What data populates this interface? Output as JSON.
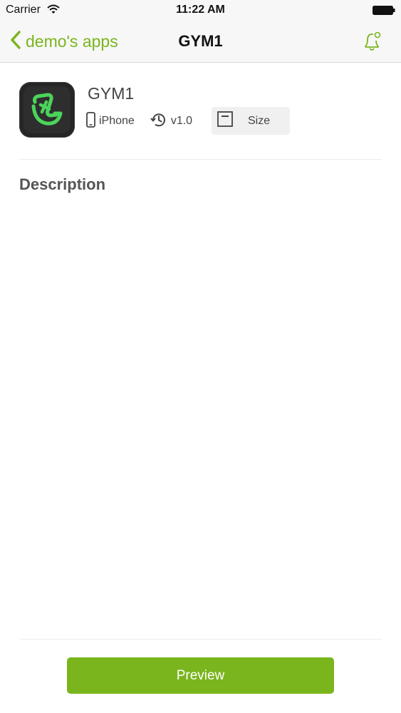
{
  "status_bar": {
    "carrier": "Carrier",
    "time": "11:22 AM",
    "wifi_icon": "wifi-icon",
    "battery_icon": "battery-icon"
  },
  "nav": {
    "back_label": "demo's apps",
    "title": "GYM1",
    "back_icon": "chevron-left-icon",
    "bell_icon": "bell-icon"
  },
  "app": {
    "name": "GYM1",
    "icon": "app-icon",
    "device": "iPhone",
    "device_icon": "phone-icon",
    "version": "v1.0",
    "version_icon": "history-icon",
    "size_label": "Size",
    "size_icon": "window-icon"
  },
  "description": {
    "heading": "Description",
    "text": ""
  },
  "actions": {
    "preview_label": "Preview"
  },
  "colors": {
    "accent": "#7ab51d",
    "nav_background": "#f7f7f7",
    "app_icon_background": "#262626",
    "app_icon_glyph": "#4bd45a"
  }
}
